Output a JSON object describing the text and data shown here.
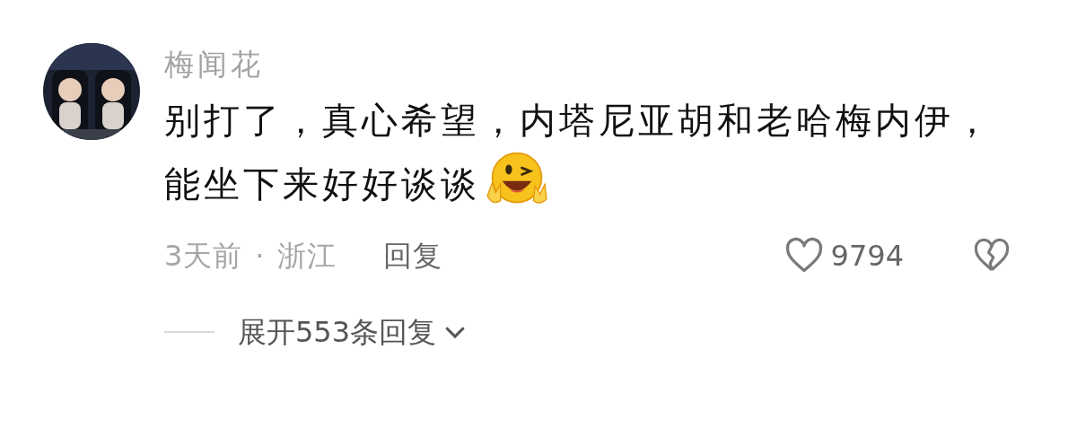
{
  "comment": {
    "author": "梅闻花",
    "text": "别打了，真心希望，内塔尼亚胡和老哈梅内伊，能坐下来好好谈谈",
    "time": "3天前",
    "separator": "·",
    "location": "浙江",
    "reply_label": "回复",
    "like_count": "9794"
  },
  "expand_replies": {
    "label": "展开553条回复"
  }
}
